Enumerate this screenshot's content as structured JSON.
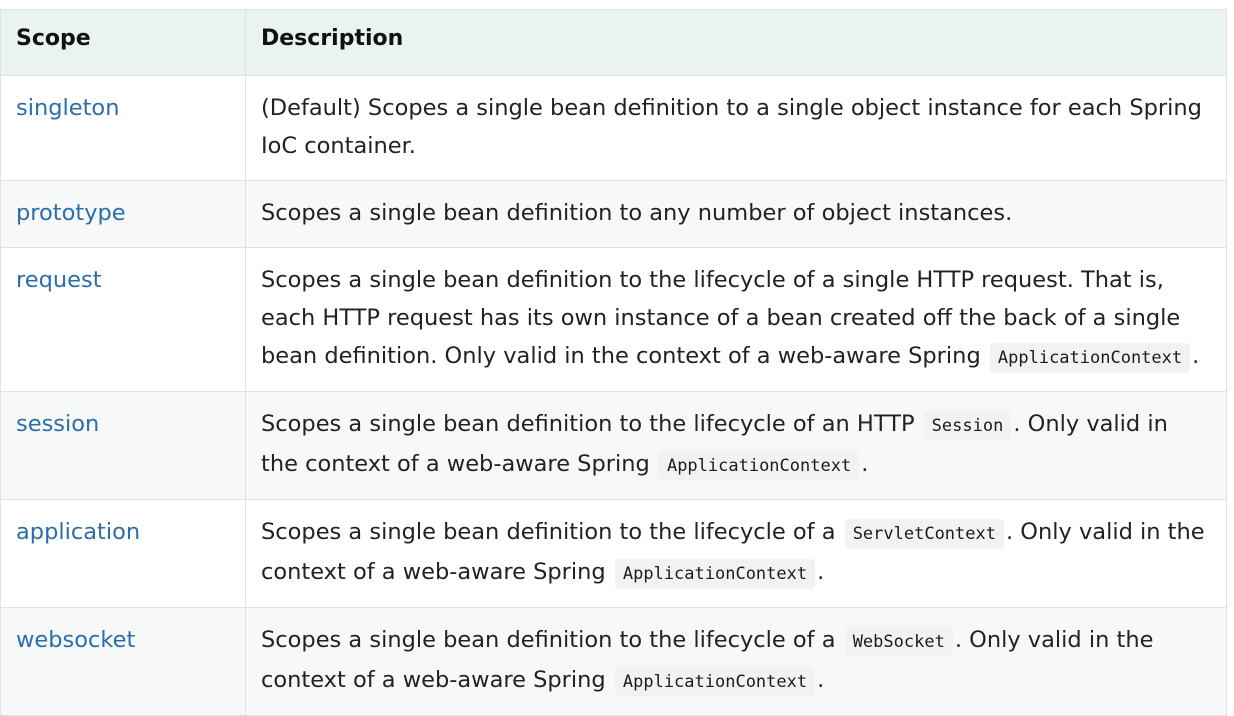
{
  "table": {
    "headers": {
      "scope": "Scope",
      "description": "Description"
    },
    "rows": [
      {
        "scope": "singleton",
        "desc": {
          "before": "(Default) Scopes a single bean definition to a single object instance for each Spring IoC container."
        }
      },
      {
        "scope": "prototype",
        "desc": {
          "before": "Scopes a single bean definition to any number of object instances."
        }
      },
      {
        "scope": "request",
        "desc": {
          "before": "Scopes a single bean definition to the lifecycle of a single HTTP request. That is, each HTTP request has its own instance of a bean created off the back of a single bean definition. Only valid in the context of a web-aware Spring",
          "code2": "ApplicationContext",
          "end": "."
        }
      },
      {
        "scope": "session",
        "desc": {
          "before": "Scopes a single bean definition to the lifecycle of an HTTP",
          "code1": "Session",
          "middle": ". Only valid in the context of a web-aware Spring",
          "code2": "ApplicationContext",
          "end": "."
        }
      },
      {
        "scope": "application",
        "desc": {
          "before": "Scopes a single bean definition to the lifecycle of a",
          "code1": "ServletContext",
          "middle": ". Only valid in the context of a web-aware Spring",
          "code2": "ApplicationContext",
          "end": "."
        }
      },
      {
        "scope": "websocket",
        "desc": {
          "before": "Scopes a single bean definition to the lifecycle of a",
          "code1": "WebSocket",
          "middle": ". Only valid in the context of a web-aware Spring",
          "code2": "ApplicationContext",
          "end": "."
        }
      }
    ]
  },
  "colors": {
    "link": "#2b6ea9",
    "header_bg": "#ebf2f2",
    "alt_row_bg": "#f7f9f9",
    "border": "#dce3e3",
    "code_bg": "#f1f3f3"
  }
}
